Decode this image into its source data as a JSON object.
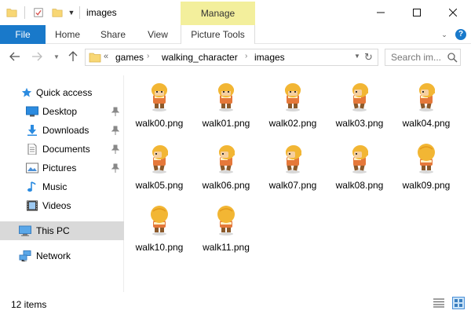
{
  "window": {
    "title": "images",
    "contextual_tab": "Manage"
  },
  "quick_access_toolbar": {
    "icons": [
      "folder-icon",
      "properties-icon",
      "new-folder-icon",
      "customize-dropdown-icon"
    ]
  },
  "ribbon": {
    "tabs": [
      "File",
      "Home",
      "Share",
      "View",
      "Picture Tools"
    ],
    "accent": "#1979ca",
    "contextual_color": "#f3ef9c"
  },
  "navigation": {
    "breadcrumb": [
      "games",
      "walking_character",
      "images"
    ],
    "overflow_chevron": "«"
  },
  "search": {
    "placeholder": "Search im..."
  },
  "sidebar": {
    "items": [
      {
        "label": "Quick access",
        "icon": "star-icon"
      },
      {
        "label": "Desktop",
        "icon": "desktop-icon",
        "pinned": true
      },
      {
        "label": "Downloads",
        "icon": "download-icon",
        "pinned": true
      },
      {
        "label": "Documents",
        "icon": "documents-icon",
        "pinned": true
      },
      {
        "label": "Pictures",
        "icon": "pictures-icon",
        "pinned": true
      },
      {
        "label": "Music",
        "icon": "music-icon"
      },
      {
        "label": "Videos",
        "icon": "videos-icon"
      },
      {
        "label": "This PC",
        "icon": "pc-icon",
        "selected": true
      },
      {
        "label": "Network",
        "icon": "network-icon"
      }
    ]
  },
  "files": [
    {
      "name": "walk00.png",
      "pose": "front"
    },
    {
      "name": "walk01.png",
      "pose": "front"
    },
    {
      "name": "walk02.png",
      "pose": "front"
    },
    {
      "name": "walk03.png",
      "pose": "side"
    },
    {
      "name": "walk04.png",
      "pose": "side"
    },
    {
      "name": "walk05.png",
      "pose": "side"
    },
    {
      "name": "walk06.png",
      "pose": "side"
    },
    {
      "name": "walk07.png",
      "pose": "side"
    },
    {
      "name": "walk08.png",
      "pose": "side"
    },
    {
      "name": "walk09.png",
      "pose": "back"
    },
    {
      "name": "walk10.png",
      "pose": "back"
    },
    {
      "name": "walk11.png",
      "pose": "back"
    }
  ],
  "status": {
    "item_count": "12 items"
  }
}
